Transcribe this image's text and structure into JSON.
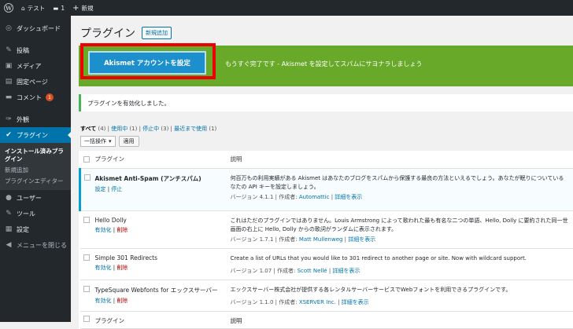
{
  "adminbar": {
    "site": "テスト",
    "comments": "1",
    "new": "新規"
  },
  "sidebar": {
    "items": [
      {
        "label": "ダッシュボード",
        "icon": "dashboard-icon",
        "glyph": "◎"
      },
      {
        "label": "投稿",
        "icon": "pin-icon",
        "glyph": "✎"
      },
      {
        "label": "メディア",
        "icon": "media-icon",
        "glyph": "▣"
      },
      {
        "label": "固定ページ",
        "icon": "page-icon",
        "glyph": "▤"
      },
      {
        "label": "コメント",
        "icon": "comment-icon",
        "glyph": "▬",
        "badge": "1"
      },
      {
        "label": "外観",
        "icon": "brush-icon",
        "glyph": "✑"
      },
      {
        "label": "プラグイン",
        "icon": "plugin-icon",
        "glyph": "✔"
      },
      {
        "label": "ユーザー",
        "icon": "user-icon",
        "glyph": "●"
      },
      {
        "label": "ツール",
        "icon": "wrench-icon",
        "glyph": "✎"
      },
      {
        "label": "設定",
        "icon": "settings-icon",
        "glyph": "▦"
      },
      {
        "label": "メニューを閉じる",
        "icon": "collapse-icon",
        "glyph": "◀"
      }
    ],
    "submenu": [
      "インストール済みプラグイン",
      "新規追加",
      "プラグインエディター"
    ]
  },
  "page": {
    "title": "プラグイン",
    "add_new": "新規追加"
  },
  "akismet": {
    "button": "Akismet アカウントを設定",
    "message": "もうすぐ完了です - Akismet を設定してスパムにサヨナラしましょう"
  },
  "notice": "プラグインを有効化しました。",
  "filters": {
    "all": "すべて",
    "all_count": "(4)",
    "active": "使用中",
    "active_count": "(1)",
    "inactive": "停止中",
    "inactive_count": "(3)",
    "recent": "最近まで使用",
    "recent_count": "(1)"
  },
  "bulk": {
    "select": "一括操作",
    "apply": "適用"
  },
  "table": {
    "col_plugin": "プラグイン",
    "col_desc": "説明",
    "rows": [
      {
        "name": "Akismet Anti-Spam (アンチスパム)",
        "actions": [
          "設定",
          "停止"
        ],
        "desc": "何百万もの利用実績がある Akismet はあなたのブログをスパムから保護する最良の方法といえるでしょう。あなたが眠りについている",
        "desc2": "なたの API キーを設定しましょう。",
        "version": "バージョン 4.1.1",
        "author": "Automattic",
        "details": "詳細を表示"
      },
      {
        "name": "Hello Dolly",
        "actions": [
          "有効化",
          "削除"
        ],
        "desc": "これはただのプラグインではありません。Louis Armstrong によって歌われた最も有名な二つの単語、Hello, Dolly に要約された同一世",
        "desc2": "画面の右上に Hello, Dolly からの歌詞がランダムに表示されます。",
        "version": "バージョン 1.7.1",
        "author": "Matt Mullenweg",
        "details": "詳細を表示"
      },
      {
        "name": "Simple 301 Redirects",
        "actions": [
          "有効化",
          "削除"
        ],
        "desc": "Create a list of URLs that you would like to 301 redirect to another page or site. Now with wildcard support.",
        "desc2": "",
        "version": "バージョン 1.07",
        "author": "Scott Nellé",
        "details": "詳細を表示"
      },
      {
        "name": "TypeSquare Webfonts for エックスサーバー",
        "actions": [
          "有効化",
          "削除"
        ],
        "desc": "エックスサーバー株式会社が提供する各レンタルサーバーサービスでWebフォントを利用できるプラグインです。",
        "desc2": "",
        "version": "バージョン 1.1.0",
        "author": "XSERVER Inc.",
        "details": "詳細を表示"
      }
    ],
    "author_prefix": "作成者:"
  }
}
